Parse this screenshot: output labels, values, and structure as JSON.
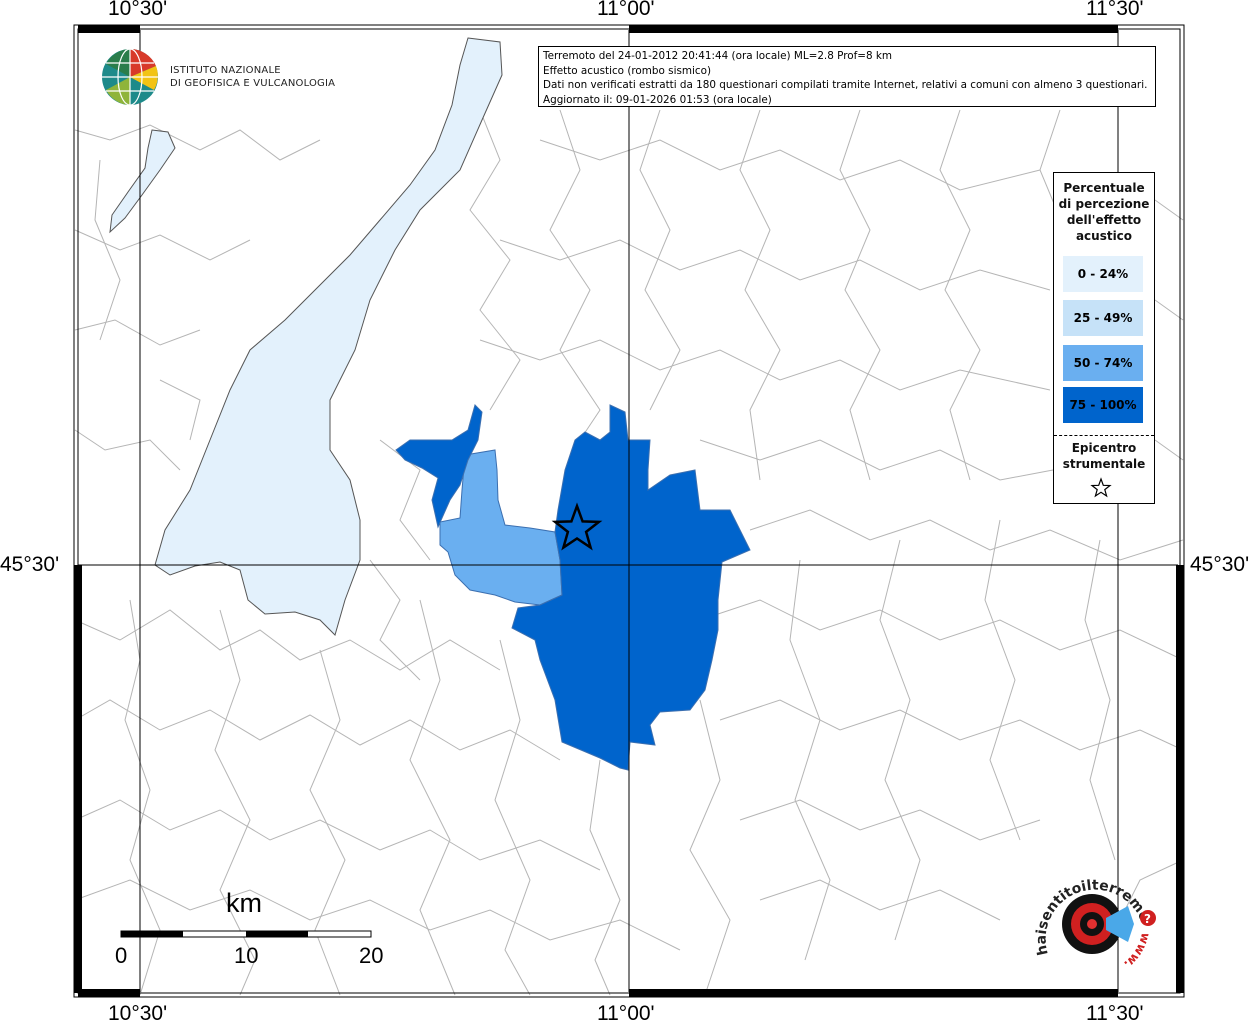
{
  "coords": {
    "top": [
      "10°30'",
      "11°00'",
      "11°30'"
    ],
    "bottom": [
      "10°30'",
      "11°00'",
      "11°30'"
    ],
    "left": "45°30'",
    "right": "45°30'"
  },
  "info": {
    "line1": "Terremoto del 24-01-2012 20:41:44 (ora locale) ML=2.8 Prof=8 km",
    "line2": "Effetto acustico (rombo sismico)",
    "line3": "Dati non verificati estratti da 180 questionari compilati tramite Internet, relativi a comuni con almeno 3 questionari.",
    "line4": "Aggiornato il: 09-01-2026 01:53 (ora locale)"
  },
  "ingv": {
    "line1": "ISTITUTO NAZIONALE",
    "line2": "DI GEOFISICA E VULCANOLOGIA"
  },
  "legend": {
    "title_lines": [
      "Percentuale",
      "di percezione",
      "dell'effetto",
      "acustico"
    ],
    "items": [
      {
        "label": "0 - 24%",
        "color": "#e3f1fc"
      },
      {
        "label": "25 - 49%",
        "color": "#c6e2f8"
      },
      {
        "label": "50 - 74%",
        "color": "#6aaff0"
      },
      {
        "label": "75 - 100%",
        "color": "#0064cc"
      }
    ],
    "epicenter_lines": [
      "Epicentro",
      "strumentale"
    ]
  },
  "scale": {
    "unit": "km",
    "ticks": [
      "0",
      "10",
      "20"
    ]
  },
  "brand": {
    "text": "haisentitoilterremoto.it",
    "prefix": "www."
  },
  "colors": {
    "lake": "#e3f1fc",
    "border": "#aaaaaa",
    "grid": "#000000"
  }
}
